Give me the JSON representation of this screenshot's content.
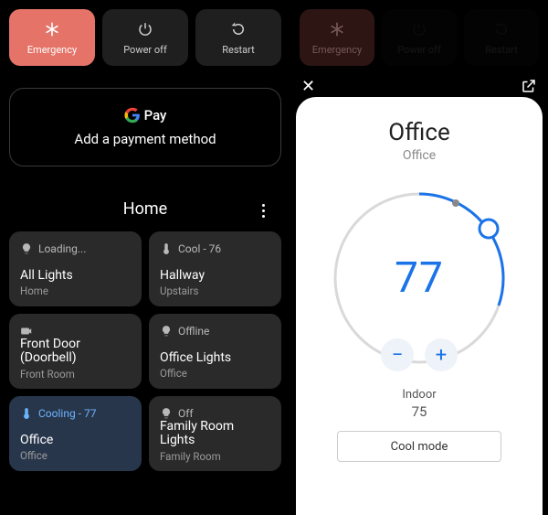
{
  "power": {
    "emergency": "Emergency",
    "power_off": "Power off",
    "restart": "Restart"
  },
  "pay": {
    "brand": "Pay",
    "prompt": "Add a payment method"
  },
  "home": {
    "title": "Home",
    "devices": [
      {
        "status": "Loading...",
        "name": "All Lights",
        "sub": "Home",
        "icon": "bulb"
      },
      {
        "status": "Cool - 76",
        "name": "Hallway",
        "sub": "Upstairs",
        "icon": "thermo"
      },
      {
        "status": "",
        "name": "Front Door (Doorbell)",
        "sub": "Front Room",
        "icon": "camera"
      },
      {
        "status": "Offline",
        "name": "Office Lights",
        "sub": "Office",
        "icon": "bulb"
      },
      {
        "status": "Cooling - 77",
        "name": "Office",
        "sub": "Office",
        "icon": "thermo",
        "active": true
      },
      {
        "status": "Off",
        "name": "Family Room Lights",
        "sub": "Family Room",
        "icon": "bulb"
      }
    ]
  },
  "thermo": {
    "title": "Office",
    "subtitle": "Office",
    "setpoint": "77",
    "indoor_label": "Indoor",
    "indoor_value": "75",
    "mode_label": "Cool mode"
  },
  "colors": {
    "accent": "#1a73e8",
    "emergency": "#e57368"
  }
}
